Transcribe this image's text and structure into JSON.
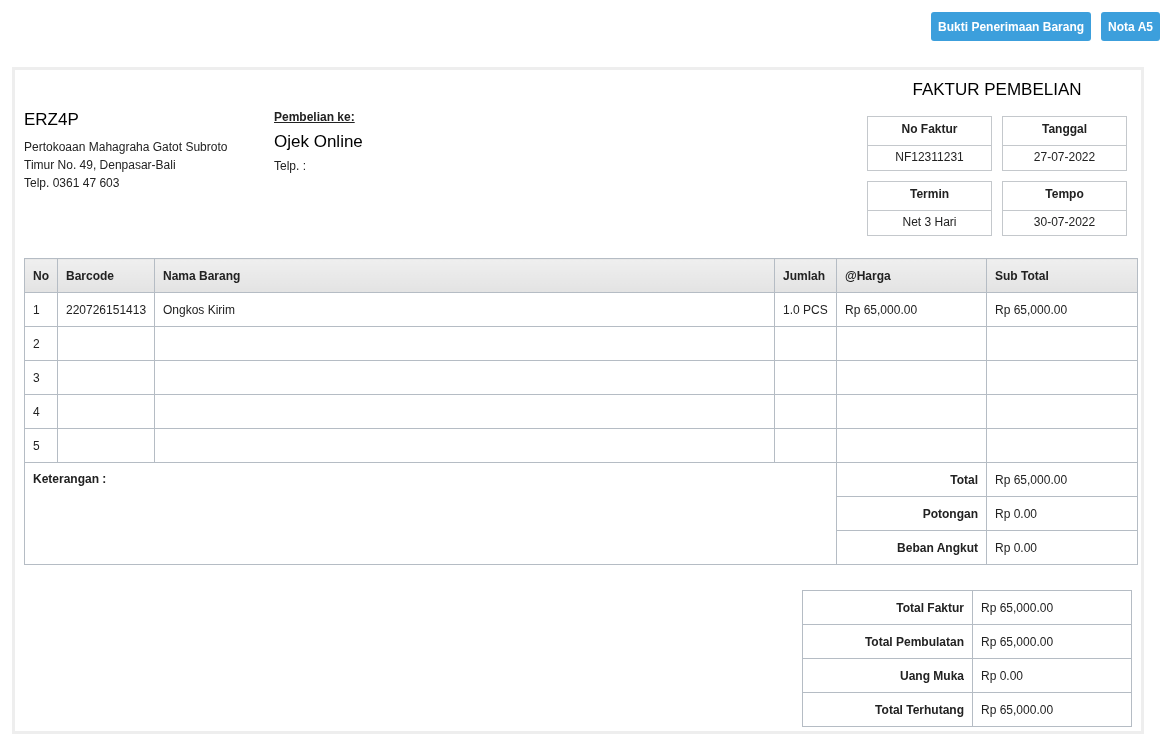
{
  "buttons": [
    "Bukti Penerimaan Barang",
    "Nota A5"
  ],
  "title": "FAKTUR PEMBELIAN",
  "company": {
    "name": "ERZ4P",
    "address_lines": [
      "Pertokoaan Mahagraha Gatot Subroto",
      "Timur No. 49, Denpasar-Bali",
      "Telp. 0361 47 603"
    ]
  },
  "supplier": {
    "label": "Pembelian ke:",
    "name": "Ojek Online",
    "phone": "Telp. :"
  },
  "info": [
    {
      "label": "No Faktur",
      "value": "NF12311231"
    },
    {
      "label": "Tanggal",
      "value": "27-07-2022"
    },
    {
      "label": "Termin",
      "value": "Net 3 Hari"
    },
    {
      "label": "Tempo",
      "value": "30-07-2022"
    }
  ],
  "table": {
    "columns": [
      "No",
      "Barcode",
      "Nama Barang",
      "Jumlah",
      "@Harga",
      "Sub Total"
    ],
    "rows": [
      {
        "no": "1",
        "barcode": "220726151413",
        "name": "Ongkos Kirim",
        "qty": "1.0 PCS",
        "price": "Rp 65,000.00",
        "subtotal": "Rp 65,000.00"
      },
      {
        "no": "2"
      },
      {
        "no": "3"
      },
      {
        "no": "4"
      },
      {
        "no": "5"
      }
    ]
  },
  "notes_label": "Keterangan :",
  "summary": [
    {
      "label": "Total",
      "value": "Rp 65,000.00"
    },
    {
      "label": "Potongan",
      "value": "Rp 0.00"
    },
    {
      "label": "Beban Angkut",
      "value": "Rp 0.00"
    }
  ],
  "totals": [
    {
      "label": "Total Faktur",
      "value": "Rp 65,000.00"
    },
    {
      "label": "Total Pembulatan",
      "value": "Rp 65,000.00"
    },
    {
      "label": "Uang Muka",
      "value": "Rp 0.00"
    },
    {
      "label": "Total Terhutang",
      "value": "Rp 65,000.00"
    }
  ]
}
